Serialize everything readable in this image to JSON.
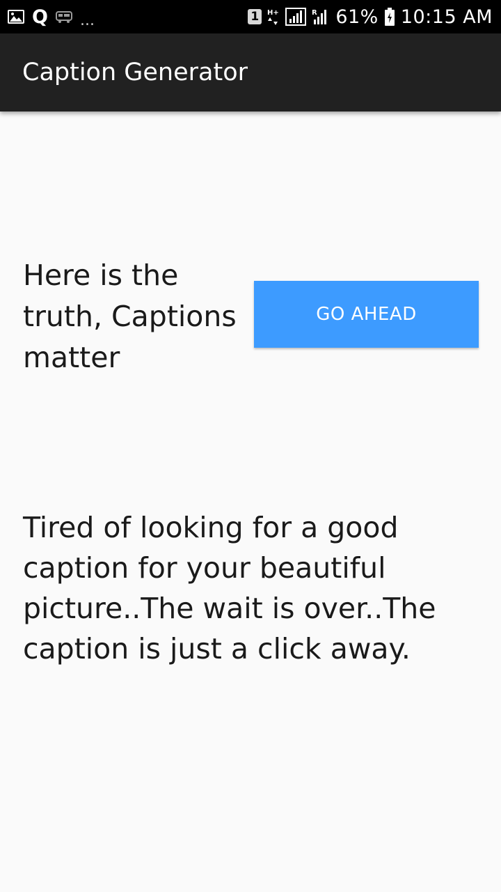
{
  "status_bar": {
    "left_icons": [
      "gallery-icon",
      "q-notification-icon",
      "bus-icon"
    ],
    "q_label": "Q",
    "more_indicator": "...",
    "sim_badge": "1",
    "network_type": "H+",
    "battery_percent": "61%",
    "time": "10:15 AM"
  },
  "app_bar": {
    "title": "Caption Generator"
  },
  "main": {
    "headline": "Here is the truth, Captions matter",
    "go_button_label": "GO AHEAD",
    "description": "Tired of looking for a good caption for your beautiful picture..The wait is over..The caption is just a click away."
  },
  "colors": {
    "status_bar_bg": "#000000",
    "app_bar_bg": "#212121",
    "page_bg": "#fafafa",
    "button_bg": "#3d9bff",
    "text": "#1a1a1a"
  }
}
